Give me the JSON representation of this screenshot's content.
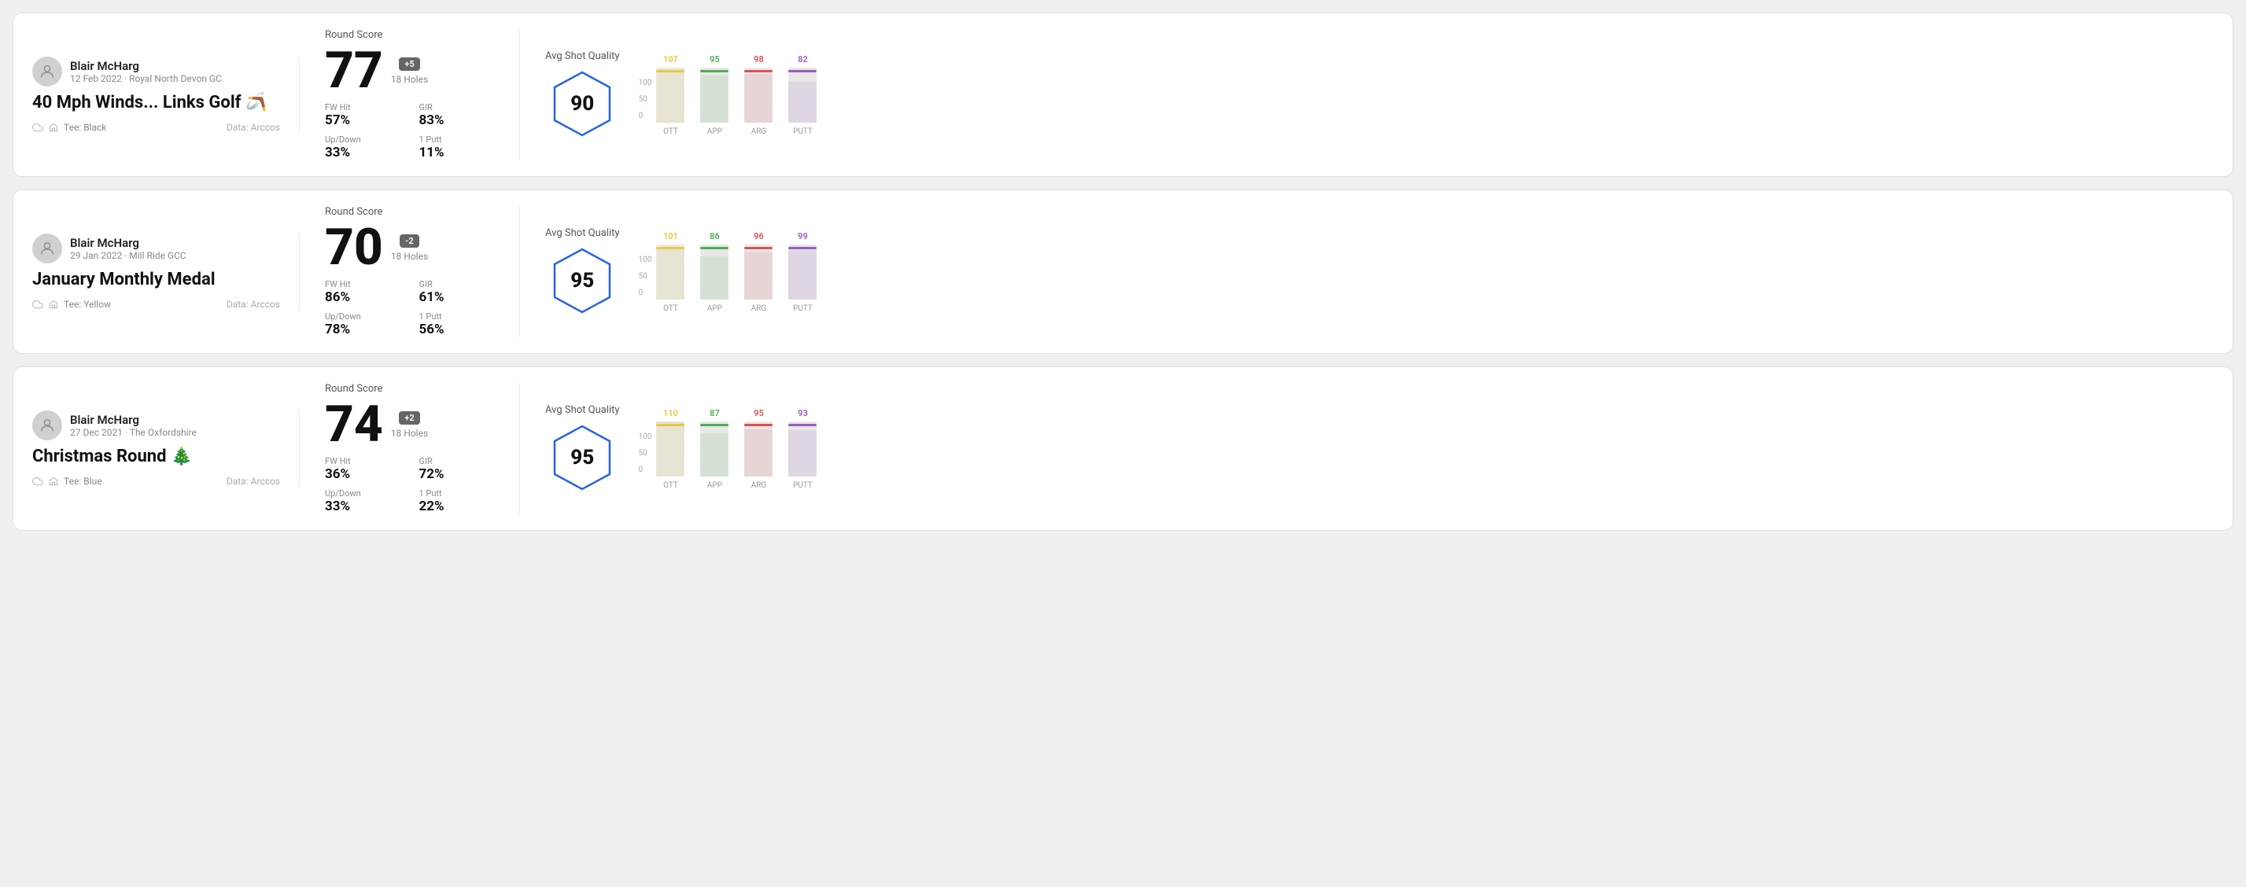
{
  "rounds": [
    {
      "id": "round1",
      "user_name": "Blair McHarg",
      "user_date": "12 Feb 2022 · Royal North Devon GC",
      "round_title": "40 Mph Winds... Links Golf 🪃",
      "tee": "Black",
      "data_source": "Data: Arccos",
      "round_score_label": "Round Score",
      "score": "77",
      "badge": "+5",
      "badge_type": "positive",
      "holes": "18 Holes",
      "fw_hit_label": "FW Hit",
      "fw_hit_value": "57%",
      "gir_label": "GIR",
      "gir_value": "83%",
      "updown_label": "Up/Down",
      "updown_value": "33%",
      "one_putt_label": "1 Putt",
      "one_putt_value": "11%",
      "avg_sq_label": "Avg Shot Quality",
      "sq_score": "90",
      "chart": {
        "bars": [
          {
            "label": "OTT",
            "value": 107,
            "color": "#e8c840",
            "height_pct": 72
          },
          {
            "label": "APP",
            "value": 95,
            "color": "#4caf50",
            "height_pct": 64
          },
          {
            "label": "ARG",
            "value": 98,
            "color": "#e05050",
            "height_pct": 66
          },
          {
            "label": "PUTT",
            "value": 82,
            "color": "#9c5bbd",
            "height_pct": 55
          }
        ],
        "y_labels": [
          "100",
          "50",
          "0"
        ]
      }
    },
    {
      "id": "round2",
      "user_name": "Blair McHarg",
      "user_date": "29 Jan 2022 · Mill Ride GCC",
      "round_title": "January Monthly Medal",
      "tee": "Yellow",
      "data_source": "Data: Arccos",
      "round_score_label": "Round Score",
      "score": "70",
      "badge": "-2",
      "badge_type": "negative",
      "holes": "18 Holes",
      "fw_hit_label": "FW Hit",
      "fw_hit_value": "86%",
      "gir_label": "GIR",
      "gir_value": "61%",
      "updown_label": "Up/Down",
      "updown_value": "78%",
      "one_putt_label": "1 Putt",
      "one_putt_value": "56%",
      "avg_sq_label": "Avg Shot Quality",
      "sq_score": "95",
      "chart": {
        "bars": [
          {
            "label": "OTT",
            "value": 101,
            "color": "#e8c840",
            "height_pct": 68
          },
          {
            "label": "APP",
            "value": 86,
            "color": "#4caf50",
            "height_pct": 58
          },
          {
            "label": "ARG",
            "value": 96,
            "color": "#e05050",
            "height_pct": 65
          },
          {
            "label": "PUTT",
            "value": 99,
            "color": "#9c5bbd",
            "height_pct": 67
          }
        ],
        "y_labels": [
          "100",
          "50",
          "0"
        ]
      }
    },
    {
      "id": "round3",
      "user_name": "Blair McHarg",
      "user_date": "27 Dec 2021 · The Oxfordshire",
      "round_title": "Christmas Round 🎄",
      "tee": "Blue",
      "data_source": "Data: Arccos",
      "round_score_label": "Round Score",
      "score": "74",
      "badge": "+2",
      "badge_type": "positive",
      "holes": "18 Holes",
      "fw_hit_label": "FW Hit",
      "fw_hit_value": "36%",
      "gir_label": "GIR",
      "gir_value": "72%",
      "updown_label": "Up/Down",
      "updown_value": "33%",
      "one_putt_label": "1 Putt",
      "one_putt_value": "22%",
      "avg_sq_label": "Avg Shot Quality",
      "sq_score": "95",
      "chart": {
        "bars": [
          {
            "label": "OTT",
            "value": 110,
            "color": "#e8c840",
            "height_pct": 74
          },
          {
            "label": "APP",
            "value": 87,
            "color": "#4caf50",
            "height_pct": 59
          },
          {
            "label": "ARG",
            "value": 95,
            "color": "#e05050",
            "height_pct": 64
          },
          {
            "label": "PUTT",
            "value": 93,
            "color": "#9c5bbd",
            "height_pct": 63
          }
        ],
        "y_labels": [
          "100",
          "50",
          "0"
        ]
      }
    }
  ]
}
